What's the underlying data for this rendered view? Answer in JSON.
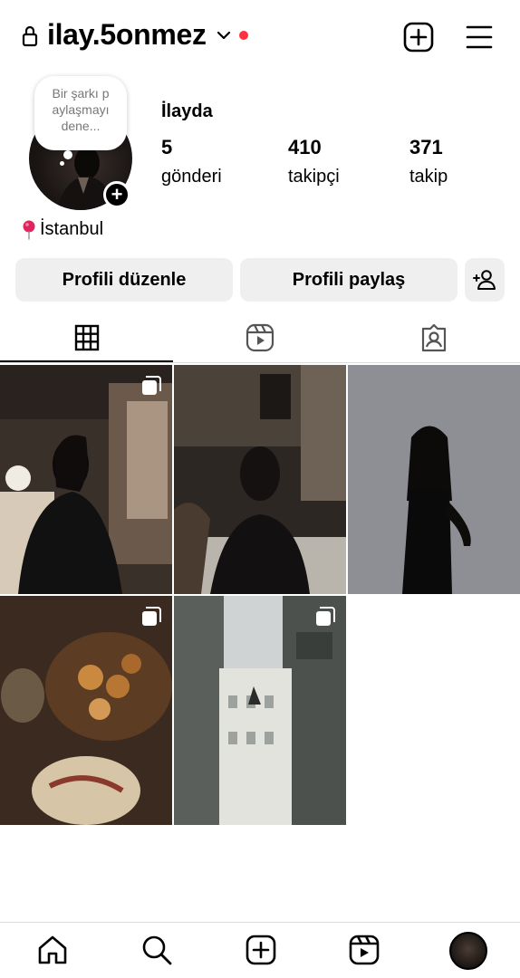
{
  "header": {
    "username": "ilay.5onmez",
    "icons": [
      "lock-icon",
      "chevron-down-icon",
      "notification-dot",
      "add-post-icon",
      "menu-icon"
    ],
    "accent_dot_color": "#ff3040"
  },
  "profile": {
    "note_text": "Bir şarkı p aylaşmayı dene...",
    "display_name": "İlayda",
    "stats": {
      "posts": {
        "value": "5",
        "label": "gönderi"
      },
      "followers": {
        "value": "410",
        "label": "takipçi"
      },
      "following": {
        "value": "371",
        "label": "takip"
      }
    },
    "location": "İstanbul"
  },
  "actions": {
    "edit_profile": "Profili düzenle",
    "share_profile": "Profili paylaş",
    "add_person_icon": "add-person-icon"
  },
  "tabs": [
    {
      "name": "grid",
      "icon": "grid-icon",
      "active": true
    },
    {
      "name": "reels",
      "icon": "reels-icon",
      "active": false
    },
    {
      "name": "tagged",
      "icon": "tagged-icon",
      "active": false
    }
  ],
  "posts": [
    {
      "scene": "cafe interior, person in black",
      "multi": true
    },
    {
      "scene": "bar/restaurant, person seated",
      "multi": false
    },
    {
      "scene": "grey wall, person in black dress",
      "multi": false
    },
    {
      "scene": "table with drinks",
      "multi": true
    },
    {
      "scene": "street with old buildings",
      "multi": true
    }
  ],
  "bottom_nav": [
    {
      "name": "home",
      "icon": "home-icon"
    },
    {
      "name": "search",
      "icon": "search-icon"
    },
    {
      "name": "create",
      "icon": "create-icon"
    },
    {
      "name": "reels",
      "icon": "reels-icon"
    },
    {
      "name": "profile",
      "icon": "profile-avatar"
    }
  ]
}
